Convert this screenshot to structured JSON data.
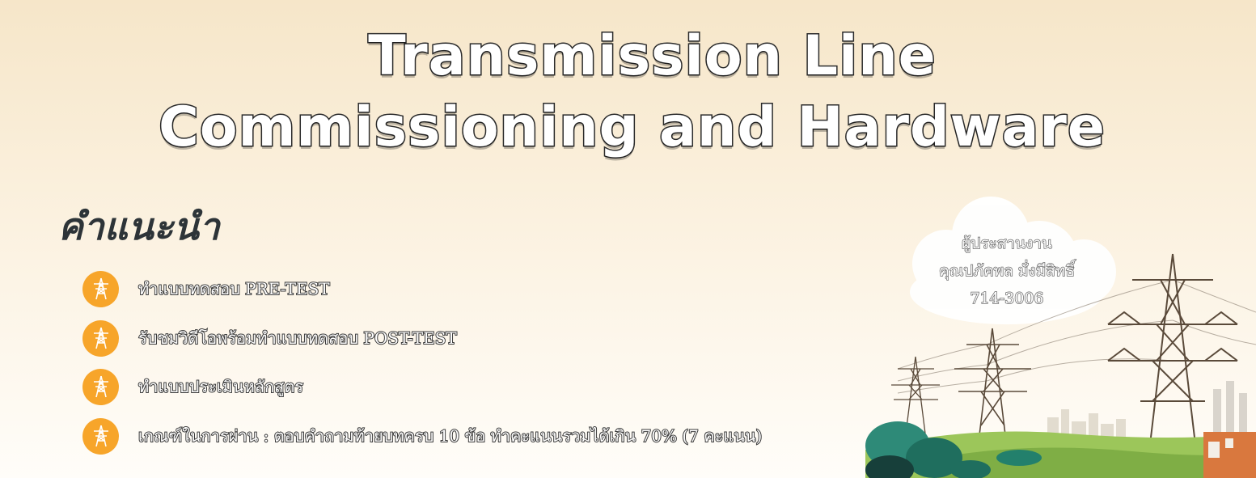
{
  "title": {
    "line1": "Transmission Line",
    "line2": "Commissioning and Hardware"
  },
  "heading": "คำแนะนำ",
  "steps": [
    {
      "icon": "power-tower-icon",
      "text": "ทำแบบทดสอบ PRE-TEST"
    },
    {
      "icon": "power-tower-icon",
      "text": "รับชมวิดีโอพร้อมทำแบบทดสอบ POST-TEST"
    },
    {
      "icon": "power-tower-icon",
      "text": "ทำแบบประเมินหลักสูตร"
    },
    {
      "icon": "power-tower-icon",
      "text": "เกณฑ์ในการผ่าน : ตอบคำถามท้ายบทครบ 10 ข้อ ทำคะแนนรวมได้เกิน 70% (7 คะแนน)"
    }
  ],
  "contact": {
    "label": "ผู้ประสานงาน",
    "name": "คุณปภัคพล มั่งมีสิทธิ์",
    "phone": "714-3006"
  },
  "colors": {
    "badge": "#f7a52a",
    "heading": "#2d3438",
    "background_top": "#f6e6c9",
    "background_bottom": "#fffdf9"
  }
}
